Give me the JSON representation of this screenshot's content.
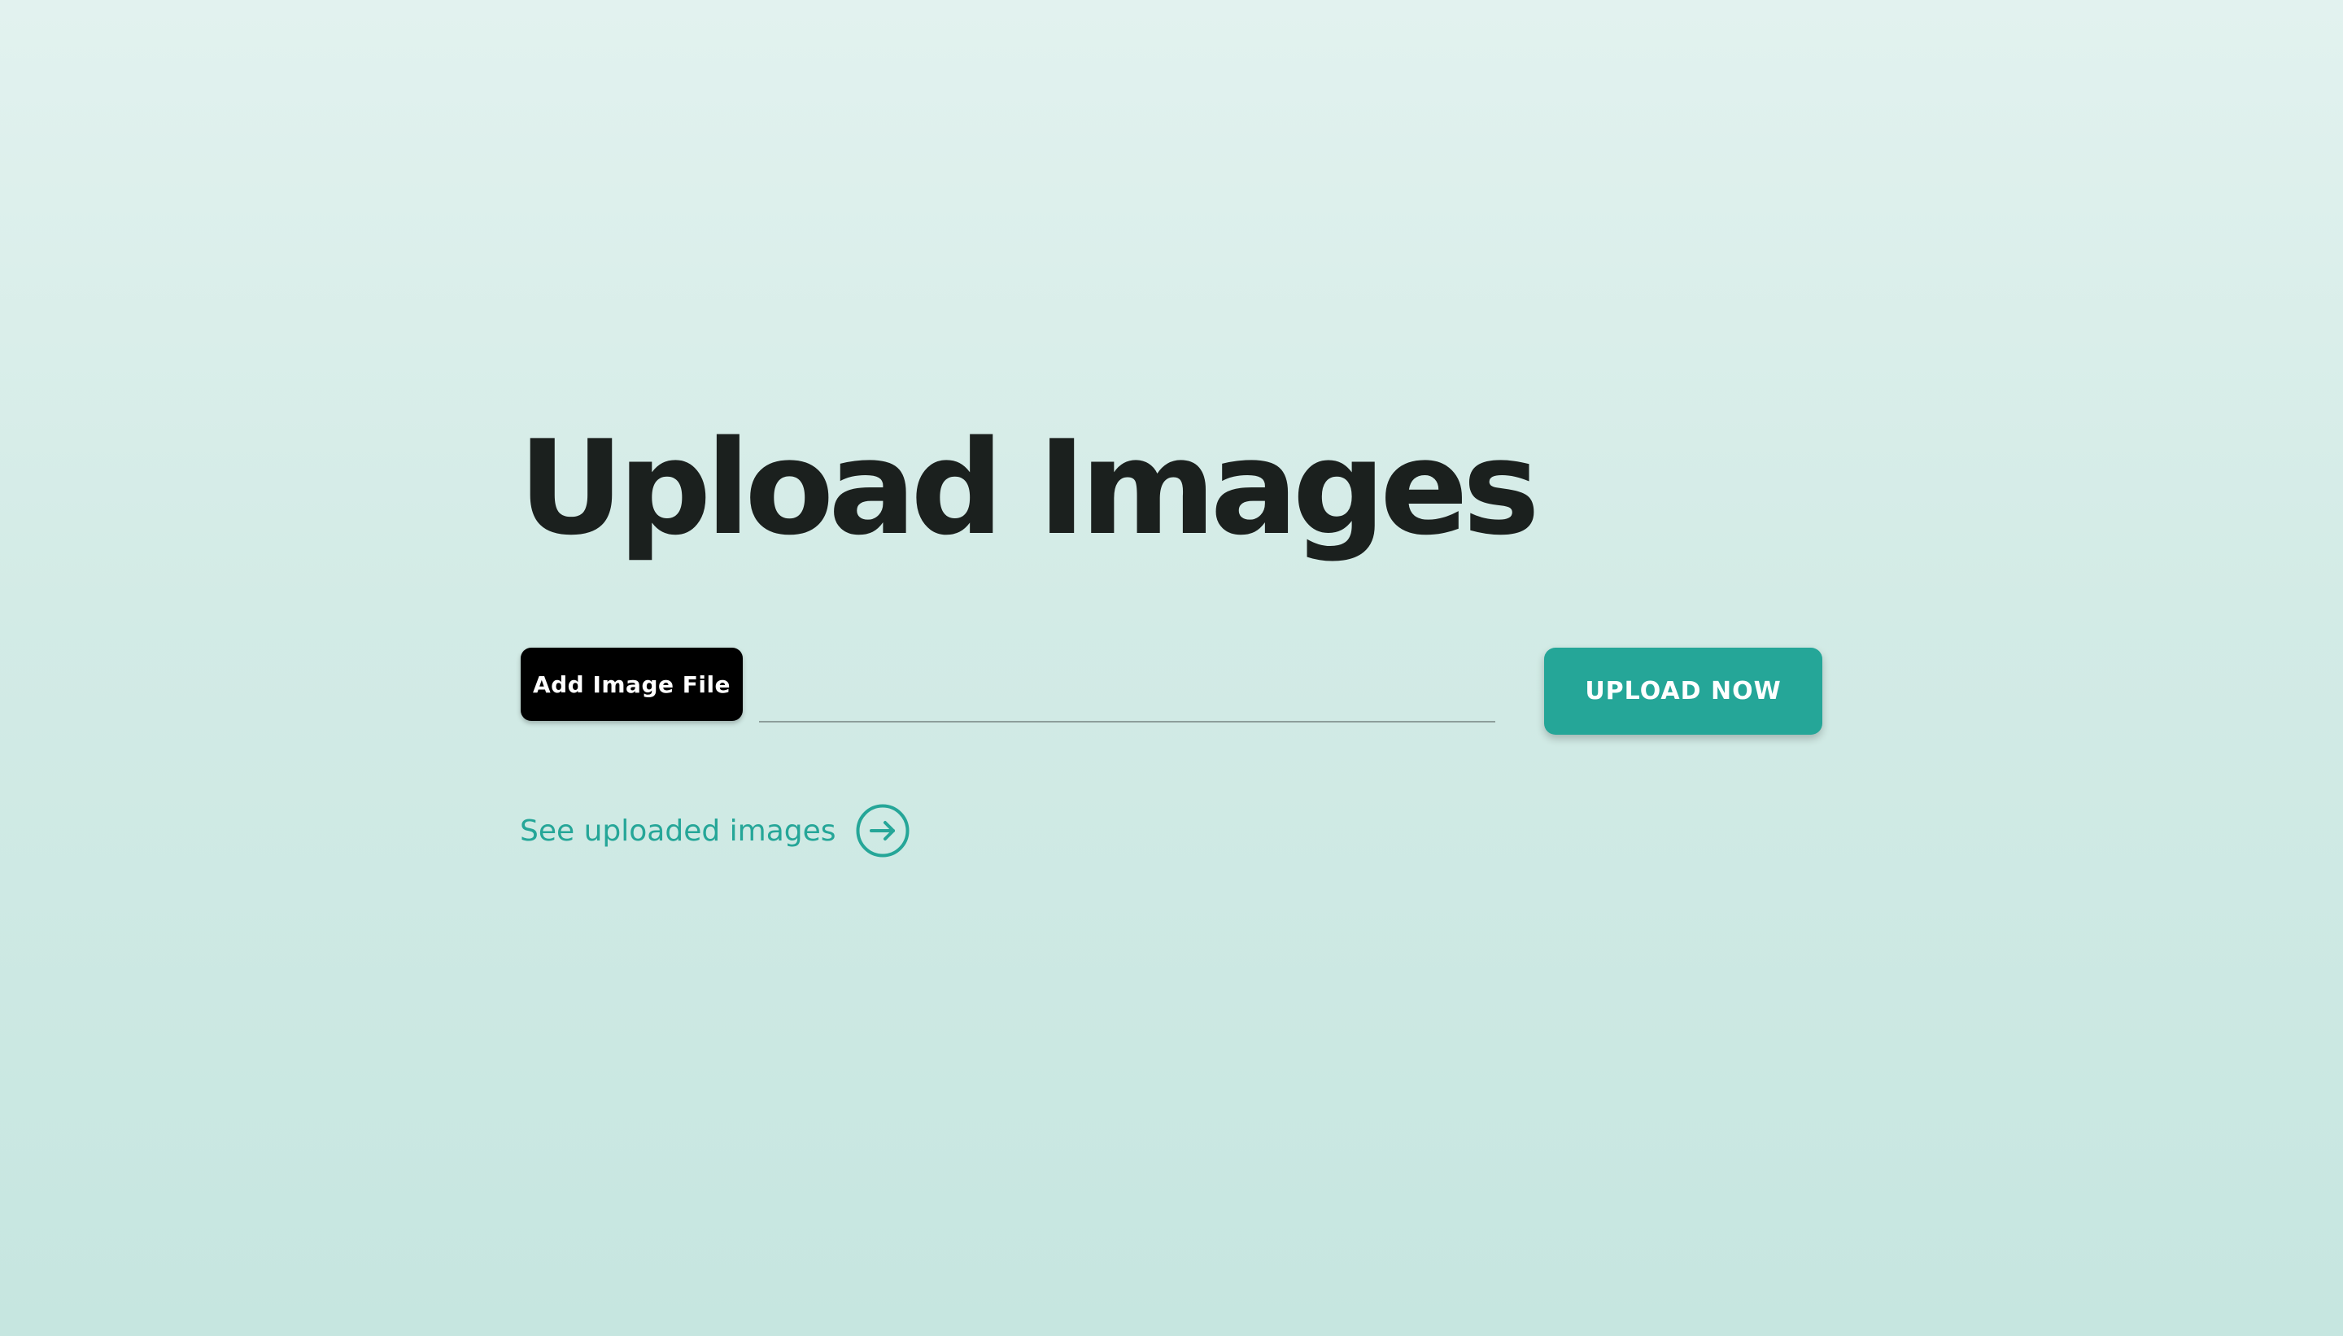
{
  "page": {
    "title": "Upload Images"
  },
  "upload_form": {
    "add_file_label": "Add Image File",
    "file_name": "",
    "upload_label": "UPLOAD NOW"
  },
  "links": {
    "see_uploaded_label": "See uploaded images",
    "see_uploaded_icon": "arrow-right-circle"
  },
  "colors": {
    "accent": "#25a698",
    "title": "#1b201e",
    "background_top": "#e2f2ef",
    "background_bottom": "#c6e6e0"
  }
}
